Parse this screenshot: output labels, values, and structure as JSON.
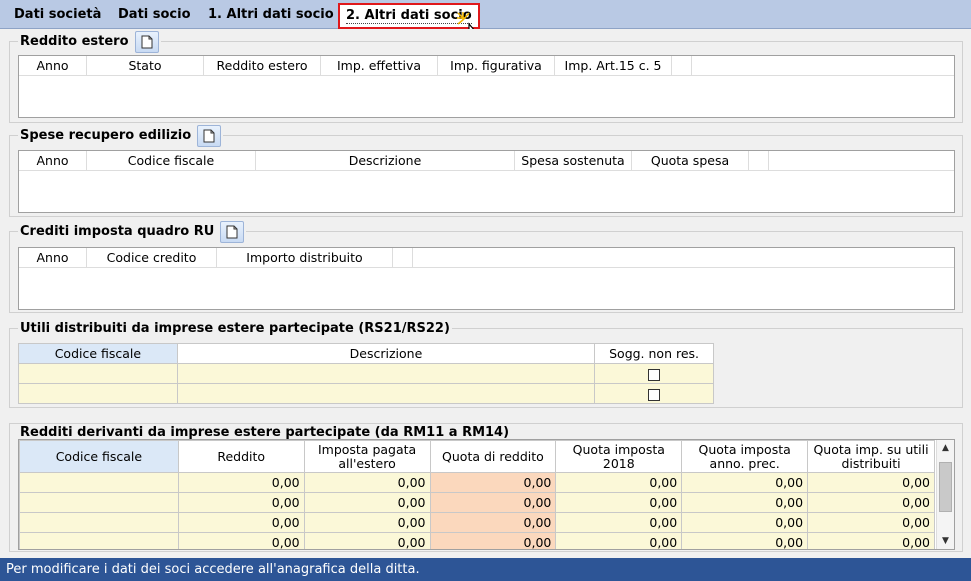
{
  "tabs": [
    {
      "label": "Dati società"
    },
    {
      "label": "Dati socio"
    },
    {
      "label": "1. Altri dati socio"
    },
    {
      "label": "2. Altri dati socio"
    }
  ],
  "sections": {
    "reddito_estero": {
      "title": "Reddito estero",
      "columns": [
        "Anno",
        "Stato",
        "Reddito estero",
        "Imp. effettiva",
        "Imp. figurativa",
        "Imp. Art.15 c. 5"
      ]
    },
    "spese_recupero": {
      "title": "Spese recupero edilizio",
      "columns": [
        "Anno",
        "Codice fiscale",
        "Descrizione",
        "Spesa sostenuta",
        "Quota spesa"
      ]
    },
    "crediti_ru": {
      "title": "Crediti imposta quadro RU",
      "columns": [
        "Anno",
        "Codice credito",
        "Importo distribuito"
      ]
    },
    "utili_distribuiti": {
      "title": "Utili distribuiti da imprese estere partecipate (RS21/RS22)",
      "columns": [
        "Codice fiscale",
        "Descrizione",
        "Sogg. non res."
      ]
    },
    "redditi_derivanti": {
      "title": "Redditi derivanti da imprese estere partecipate (da RM11 a RM14)",
      "columns": [
        "Codice fiscale",
        "Reddito",
        "Imposta pagata all'estero",
        "Quota di reddito",
        "Quota imposta 2018",
        "Quota imposta anno. prec.",
        "Quota imp. su utili distribuiti"
      ],
      "rows": [
        [
          "",
          "0,00",
          "0,00",
          "0,00",
          "0,00",
          "0,00",
          "0,00"
        ],
        [
          "",
          "0,00",
          "0,00",
          "0,00",
          "0,00",
          "0,00",
          "0,00"
        ],
        [
          "",
          "0,00",
          "0,00",
          "0,00",
          "0,00",
          "0,00",
          "0,00"
        ],
        [
          "",
          "0,00",
          "0,00",
          "0,00",
          "0,00",
          "0,00",
          "0,00"
        ]
      ]
    }
  },
  "status": "Per modificare i dati dei soci accedere all'anagrafica della ditta."
}
